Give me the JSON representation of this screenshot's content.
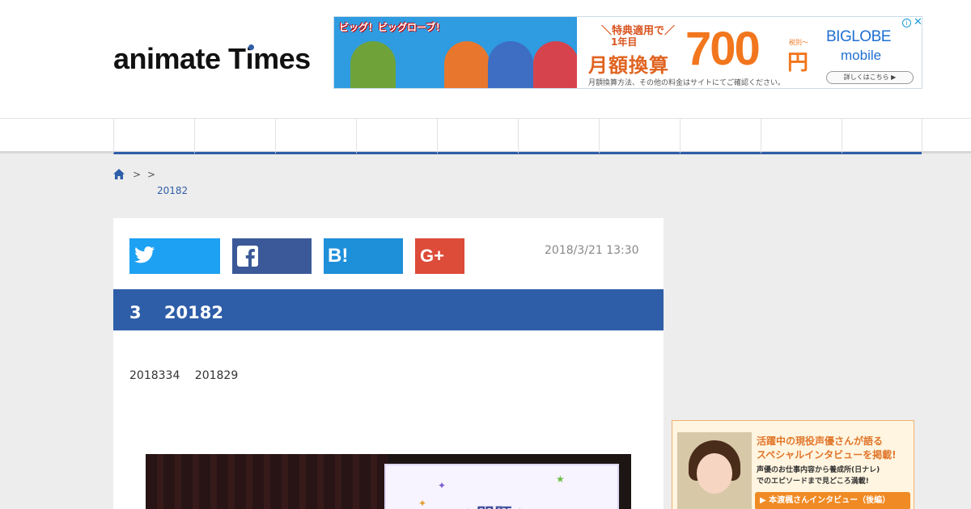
{
  "header": {
    "logo_text_a": "anima",
    "logo_text_b": "te T",
    "logo_text_i": "i",
    "logo_text_c": "mes"
  },
  "ad": {
    "title": "ビッグ！ビッグローブ！",
    "tag": "＼特典適用で／",
    "year": "1年目",
    "monthly": "月額換算",
    "price": "700",
    "yen": "円",
    "tax_note": "税別～",
    "small_note": "月額換算方法、その他の料金はサイトにてご確認ください。",
    "brand": "BIGLOBE",
    "brand_sub": "mobile",
    "button": "詳しくはこちら ▶",
    "info": "i",
    "close": "✕"
  },
  "nav": {
    "items": [
      "",
      "",
      "",
      "",
      "",
      "",
      "",
      "",
      "",
      ""
    ]
  },
  "breadcrumb": {
    "sep1": ">",
    "sep2": ">",
    "current": "20182"
  },
  "article": {
    "date": "2018/3/21 13:30",
    "title": "3　 20182",
    "lead": "2018334　 201829",
    "photo_screen_text": "☆問題☆"
  },
  "banner": {
    "line1": "活躍中の現役声優さんが語る",
    "line2": "スペシャルインタビューを掲載!",
    "line3": "声優のお仕事内容から養成所(日ナレ)",
    "line4": "でのエピソードまで見どころ満載!",
    "button": "▶ 本渡楓さんインタビュー（後編）"
  },
  "colors": {
    "brand_blue": "#2f5ea8",
    "twitter": "#1da1f2",
    "facebook": "#3b5998",
    "hatena": "#1e8fd9",
    "google_plus": "#dd4b39"
  }
}
